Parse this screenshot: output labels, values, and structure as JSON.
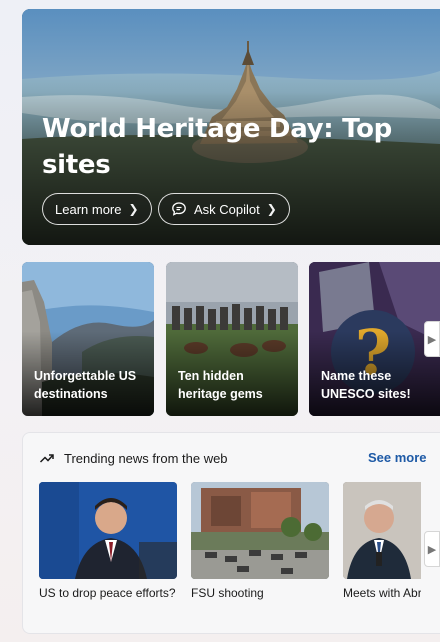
{
  "hero": {
    "title": "World Heritage Day: Top sites",
    "learn_more": "Learn more",
    "ask_copilot": "Ask Copilot"
  },
  "cards": [
    {
      "caption": "Unforgettable US destinations"
    },
    {
      "caption": "Ten hidden heritage gems"
    },
    {
      "caption": "Name these UNESCO sites!"
    }
  ],
  "trending": {
    "heading": "Trending news from the web",
    "see_more": "See more",
    "items": [
      {
        "caption": "US to drop peace efforts?"
      },
      {
        "caption": "FSU shooting"
      },
      {
        "caption": "Meets with Abr"
      }
    ]
  },
  "icons": {
    "chevron": "chevron-right-icon",
    "copilot": "chat-bubble-icon",
    "trend": "trending-arrow-icon"
  },
  "colors": {
    "accent_link": "#1e5aa6",
    "panel_bg": "#f7f7f8"
  }
}
